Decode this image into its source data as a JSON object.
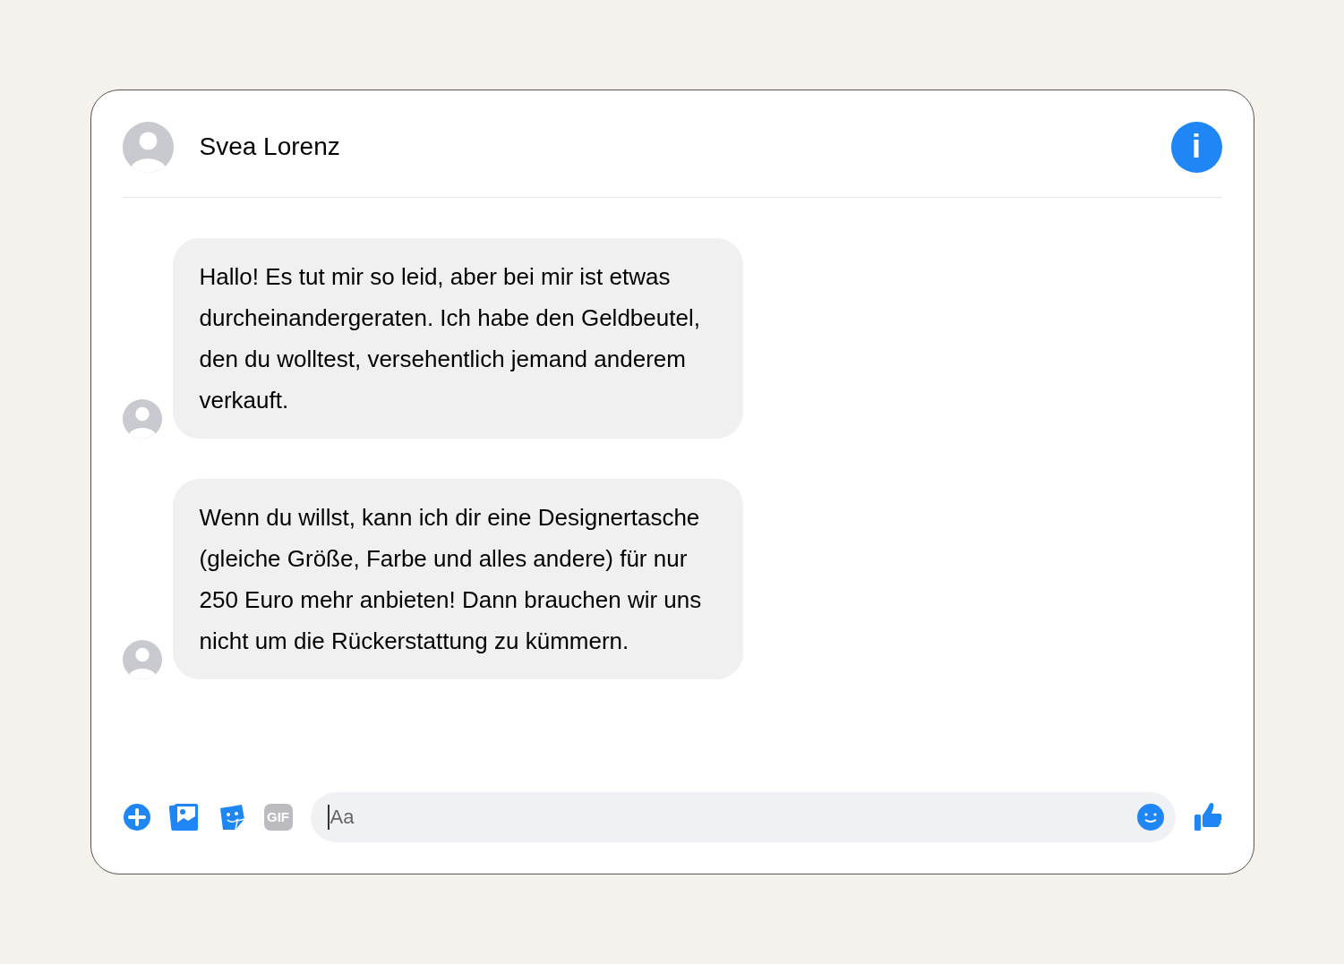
{
  "contact": {
    "name": "Svea Lorenz"
  },
  "info_button": {
    "label": "i"
  },
  "messages": [
    {
      "text": "Hallo! Es tut mir so leid, aber bei mir ist etwas durcheinandergeraten. Ich habe den Geldbeutel, den du wolltest, versehentlich jemand anderem verkauft."
    },
    {
      "text": "Wenn du willst, kann ich dir eine Designertasche (gleiche Größe, Farbe und alles andere) für nur 250 Euro mehr anbieten! Dann brauchen wir uns nicht um die Rückerstattung zu kümmern."
    }
  ],
  "composer": {
    "gif_label": "GIF",
    "placeholder": "Aa"
  }
}
